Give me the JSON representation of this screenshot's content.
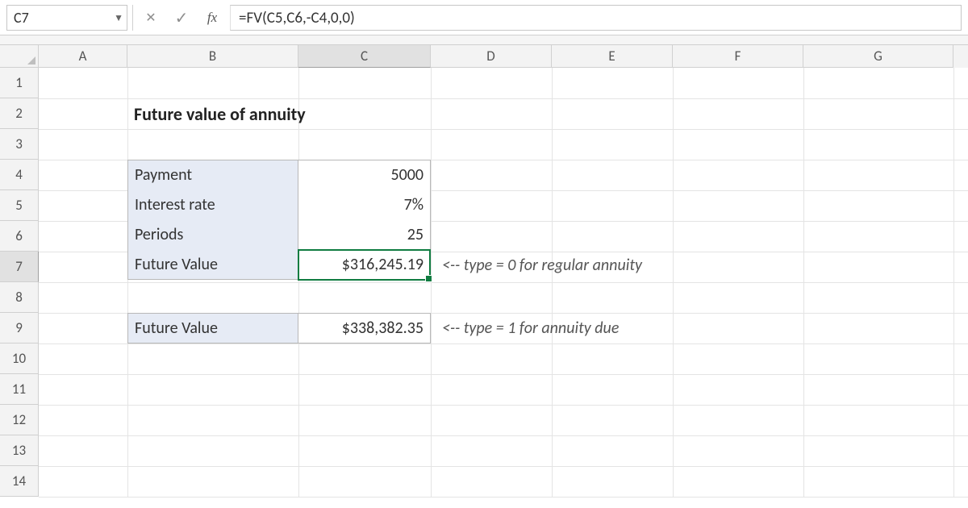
{
  "formula_bar": {
    "cell_ref": "C7",
    "formula": "=FV(C5,C6,-C4,0,0)"
  },
  "columns": [
    "A",
    "B",
    "C",
    "D",
    "E",
    "F",
    "G"
  ],
  "rows": [
    "1",
    "2",
    "3",
    "4",
    "5",
    "6",
    "7",
    "8",
    "9",
    "10",
    "11",
    "12",
    "13",
    "14"
  ],
  "selected_col": "C",
  "selected_row": "7",
  "content": {
    "title": "Future value of annuity",
    "rows": {
      "payment": {
        "label": "Payment",
        "value": "5000"
      },
      "rate": {
        "label": "Interest rate",
        "value": "7%"
      },
      "periods": {
        "label": "Periods",
        "value": "25"
      },
      "fv1": {
        "label": "Future Value",
        "value": "$316,245.19",
        "note": "<-- type = 0 for regular annuity"
      },
      "fv2": {
        "label": "Future Value",
        "value": "$338,382.35",
        "note": "<-- type = 1 for annuity due"
      }
    }
  }
}
